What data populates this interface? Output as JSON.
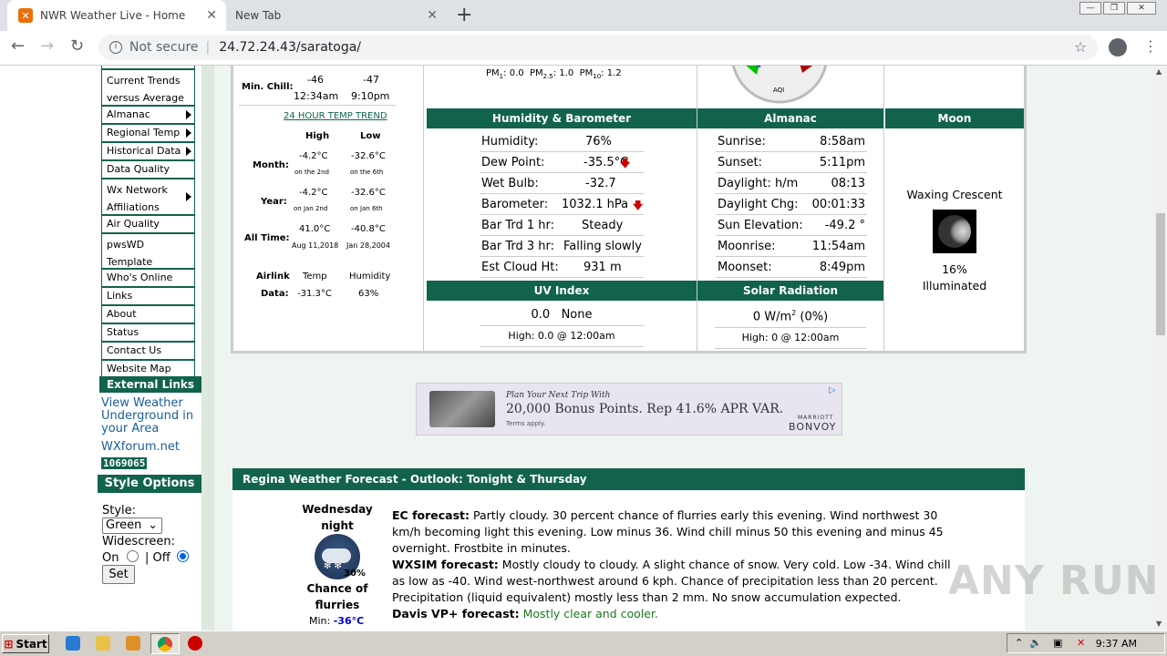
{
  "browser": {
    "tabs": [
      {
        "title": "NWR Weather Live - Home",
        "icon": "xampp-icon"
      },
      {
        "title": "New Tab"
      }
    ],
    "address": {
      "security": "Not secure",
      "url": "24.72.24.43/saratoga/"
    }
  },
  "sidebar": {
    "menu": [
      {
        "label": "Current Trends versus Average",
        "arrow": false
      },
      {
        "label": "Almanac",
        "arrow": true
      },
      {
        "label": "Regional Temp",
        "arrow": true
      },
      {
        "label": "Historical Data",
        "arrow": true
      },
      {
        "label": "Data Quality",
        "arrow": false
      },
      {
        "label": "Wx Network Affiliations",
        "arrow": true
      },
      {
        "label": "Air Quality",
        "arrow": false
      },
      {
        "label": "pwsWD Template",
        "arrow": false
      },
      {
        "label": "Who's Online",
        "arrow": false
      },
      {
        "label": "Links",
        "arrow": false
      },
      {
        "label": "About",
        "arrow": false
      },
      {
        "label": "Status",
        "arrow": false
      },
      {
        "label": "Contact Us",
        "arrow": false
      },
      {
        "label": "Website Map",
        "arrow": false
      }
    ],
    "external_links_header": "External Links",
    "external_links": [
      "View Weather Underground in your Area",
      "WXforum.net"
    ],
    "counter": "1069065",
    "style_options_header": "Style Options",
    "style_label": "Style:",
    "style_value": "Green",
    "widescreen_label": "Widescreen:",
    "on_label": "On",
    "off_label": "| Off",
    "set_button": "Set"
  },
  "temps": {
    "min_chill_label": "Min. Chill:",
    "min_chill_values": [
      "-46",
      "-47"
    ],
    "min_chill_times": [
      "12:34am",
      "9:10pm"
    ],
    "trend_link": "24 HOUR TEMP TREND",
    "high_label": "High",
    "low_label": "Low",
    "rows": [
      {
        "label": "Month:",
        "high": "-4.2°C",
        "high_date": "on the 2nd",
        "low": "-32.6°C",
        "low_date": "on the 6th"
      },
      {
        "label": "Year:",
        "high": "-4.2°C",
        "high_date": "on Jan 2nd",
        "low": "-32.6°C",
        "low_date": "on Jan 6th"
      },
      {
        "label": "All Time:",
        "high": "41.0°C",
        "high_date": "Aug 11,2018",
        "low": "-40.8°C",
        "low_date": "Jan 28,2004"
      }
    ],
    "airlink_label": "Airlink",
    "data_label": "Data:",
    "airlink_temp_label": "Temp",
    "airlink_humidity_label": "Humidity",
    "airlink_temp": "-31.3°C",
    "airlink_humidity": "63%"
  },
  "pm": {
    "pm1": "0.0",
    "pm25": "1.0",
    "pm10": "1.2"
  },
  "aqi_label": "AQI",
  "humidity_barometer": {
    "header": "Humidity & Barometer",
    "rows": [
      {
        "label": "Humidity:",
        "value": "76%"
      },
      {
        "label": "Dew Point:",
        "value": "-35.5°C",
        "trend": "down"
      },
      {
        "label": "Wet Bulb:",
        "value": "-32.7"
      },
      {
        "label": "Barometer:",
        "value": "1032.1 hPa",
        "trend": "down"
      },
      {
        "label": "Bar Trd 1 hr:",
        "value": "Steady"
      },
      {
        "label": "Bar Trd 3 hr:",
        "value": "Falling slowly"
      },
      {
        "label": "Est Cloud Ht:",
        "value": "931 m"
      }
    ]
  },
  "almanac": {
    "header": "Almanac",
    "rows": [
      {
        "label": "Sunrise:",
        "value": "8:58am"
      },
      {
        "label": "Sunset:",
        "value": "5:11pm"
      },
      {
        "label": "Daylight: h/m",
        "value": "08:13"
      },
      {
        "label": "Daylight Chg:",
        "value": "00:01:33"
      },
      {
        "label": "Sun Elevation:",
        "value": "-49.2 °"
      },
      {
        "label": "Moonrise:",
        "value": "11:54am"
      },
      {
        "label": "Moonset:",
        "value": "8:49pm"
      }
    ]
  },
  "moon": {
    "header": "Moon",
    "phase": "Waxing Crescent",
    "illumination": "16%",
    "illuminated_label": "Illuminated"
  },
  "uv": {
    "header": "UV Index",
    "value": "0.0",
    "desc": "None",
    "high": "High: 0.0 @ 12:00am"
  },
  "solar": {
    "header": "Solar Radiation",
    "value": "0 W/m",
    "pct": "(0%)",
    "high": "High: 0 @ 12:00am"
  },
  "ad": {
    "line1": "Plan Your Next Trip With",
    "line2": "20,000 Bonus Points. Rep 41.6% APR VAR.",
    "line3": "Terms apply.",
    "brand1": "MARRIOTT",
    "brand2": "BONVOY"
  },
  "forecast": {
    "header": "Regina Weather Forecast  - Outlook: Tonight & Thursday",
    "period": "Wednesday night",
    "pop": "30%",
    "condition": "Chance of flurries",
    "min_label": "Min:",
    "min_value": "-36°C",
    "ec_label": "EC forecast:",
    "ec_text": "Partly cloudy. 30 percent chance of flurries early this evening. Wind northwest 30 km/h becoming light this evening. Low minus 36. Wind chill minus 50 this evening and minus 45 overnight. Frostbite in minutes.",
    "wxsim_label": "WXSIM forecast:",
    "wxsim_text": "Mostly cloudy to cloudy. A slight chance of snow. Very cold. Low -34. Wind chill as low as -40. Wind west-northwest around 6 kph. Chance of precipitation less than 20 percent. Precipitation (liquid equivalent) mostly less than 2 mm. No snow accumulation expected.",
    "davis_label": "Davis VP+ forecast:",
    "davis_text": "Mostly clear and cooler."
  },
  "taskbar": {
    "start": "Start",
    "time": "9:37 AM"
  },
  "watermark": "ANY RUN",
  "colors": {
    "accent": "#11634e",
    "link": "#1a5e9c",
    "trend_down": "#cc0000"
  }
}
